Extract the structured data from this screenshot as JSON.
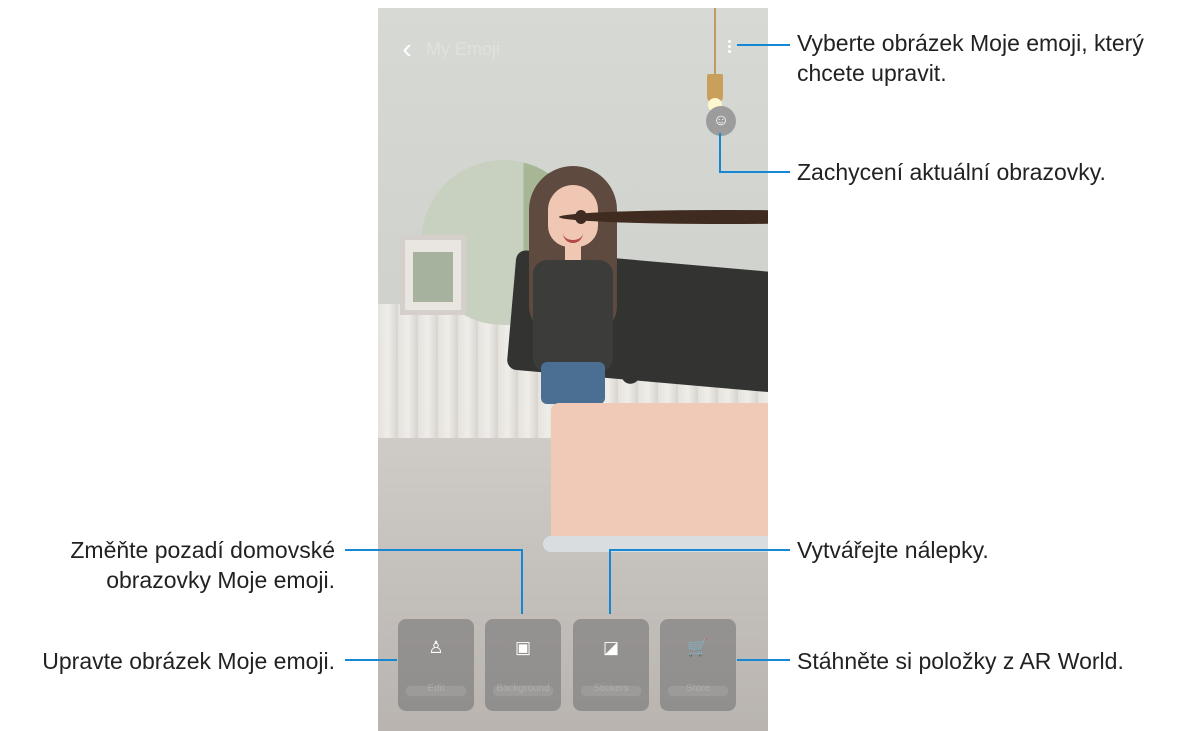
{
  "callouts": {
    "select_emoji": "Vyberte obrázek Moje emoji, který chcete upravit.",
    "capture_screen": "Zachycení aktuální obrazovky.",
    "change_background": "Změňte pozadí domovské obrazovky Moje emoji.",
    "create_stickers": "Vytvářejte nálepky.",
    "edit_emoji": "Upravte obrázek Moje emoji.",
    "download_items": "Stáhněte si položky z AR World."
  },
  "app": {
    "title": "My Emoji",
    "back_icon": "back-icon",
    "more_icon": "more-options-icon",
    "capture_icon": "face-capture-icon",
    "accent_color": "#1688d3"
  },
  "bottom_actions": [
    {
      "label": "Edit",
      "icon": "person-icon"
    },
    {
      "label": "Background",
      "icon": "image-icon"
    },
    {
      "label": "Stickers",
      "icon": "sticker-icon"
    },
    {
      "label": "Store",
      "icon": "cart-icon"
    }
  ]
}
